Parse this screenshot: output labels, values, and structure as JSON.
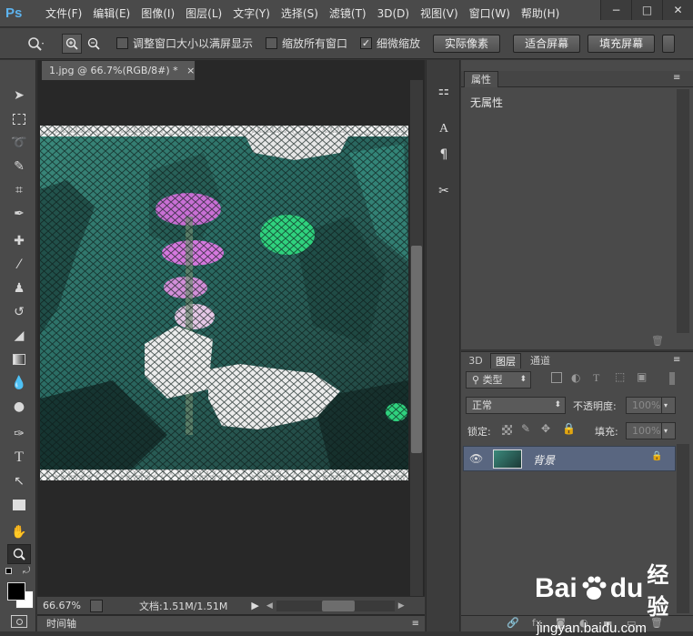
{
  "app": {
    "logo": "Ps"
  },
  "menu": [
    "文件(F)",
    "编辑(E)",
    "图像(I)",
    "图层(L)",
    "文字(Y)",
    "选择(S)",
    "滤镜(T)",
    "3D(D)",
    "视图(V)",
    "窗口(W)",
    "帮助(H)"
  ],
  "window_controls": {
    "minimize": "−",
    "maximize": "□",
    "close": "✕"
  },
  "options_bar": {
    "resize_windows": {
      "label": "调整窗口大小以满屏显示",
      "checked": false
    },
    "zoom_all": {
      "label": "缩放所有窗口",
      "checked": false
    },
    "scrubby_zoom": {
      "label": "细微缩放",
      "checked": true
    },
    "btn_actual_pixels": "实际像素",
    "btn_fit_screen": "适合屏幕",
    "btn_fill_screen": "填充屏幕"
  },
  "document": {
    "tab_title": "1.jpg @ 66.7%(RGB/8#) *",
    "close_glyph": "×"
  },
  "status": {
    "zoom": "66.67%",
    "doc_info": "文档:1.51M/1.51M"
  },
  "timeline": {
    "label": "时间轴"
  },
  "properties": {
    "tab": "属性",
    "content": "无属性"
  },
  "layers": {
    "tabs": [
      "3D",
      "图层",
      "通道"
    ],
    "active_tab": "图层",
    "filter_kind": "类型",
    "blend_mode": "正常",
    "opacity_label": "不透明度:",
    "opacity_value": "100%",
    "lock_label": "锁定:",
    "fill_label": "填充:",
    "fill_value": "100%",
    "layer_name": "背景"
  },
  "watermark": {
    "brand": "Bai",
    "brand2": "du",
    "suffix": "经验",
    "url": "jingyan.baidu.com"
  },
  "colors": {
    "accent": "#5db3ee",
    "layer_selected": "#596680"
  }
}
